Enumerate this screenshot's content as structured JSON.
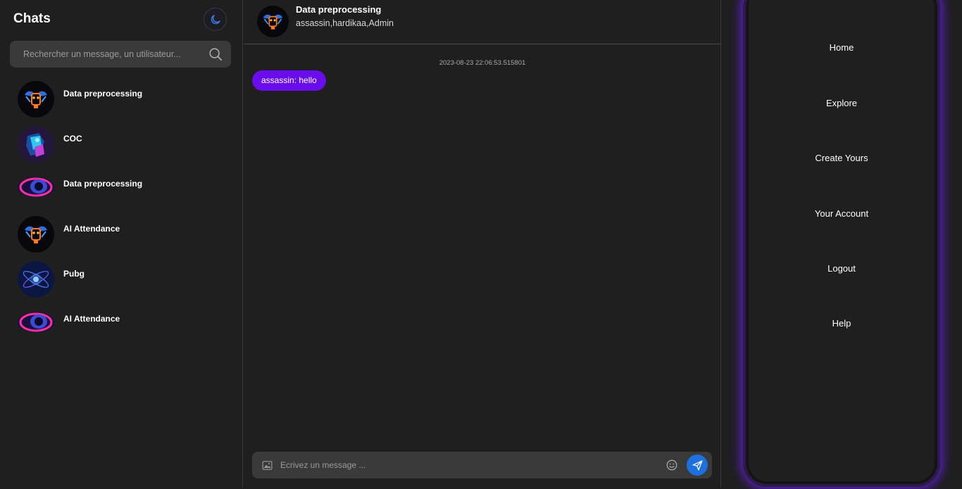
{
  "sidebar": {
    "title": "Chats",
    "theme_toggle_icon": "moon-icon",
    "search": {
      "placeholder": "Rechercher un message, un utilisateur..."
    },
    "chats": [
      {
        "name": "Data preprocessing",
        "avatar": "mech-skull-avatar"
      },
      {
        "name": "COC",
        "avatar": "neon-figure-avatar"
      },
      {
        "name": "Data preprocessing",
        "avatar": "pink-planet-avatar"
      },
      {
        "name": "AI Attendance",
        "avatar": "mech-skull-avatar"
      },
      {
        "name": "Pubg",
        "avatar": "blue-atom-avatar"
      },
      {
        "name": "AI Attendance",
        "avatar": "pink-planet-avatar"
      }
    ]
  },
  "chat": {
    "title": "Data preprocessing",
    "members": "assassin,hardikaa,Admin",
    "messages": [
      {
        "timestamp": "2023-08-23 22:06:53.515801",
        "text": "assassin: hello"
      }
    ],
    "composer": {
      "placeholder": "Ecrivez un message ..."
    }
  },
  "nav": {
    "items": [
      "Home",
      "Explore",
      "Create Yours",
      "Your Account",
      "Logout",
      "Help"
    ]
  },
  "colors": {
    "background": "#1f1f1f",
    "input": "#3a3a3a",
    "bubble": "#6a0dec",
    "send": "#1e6fe0",
    "glow": "#5a1fc0"
  }
}
